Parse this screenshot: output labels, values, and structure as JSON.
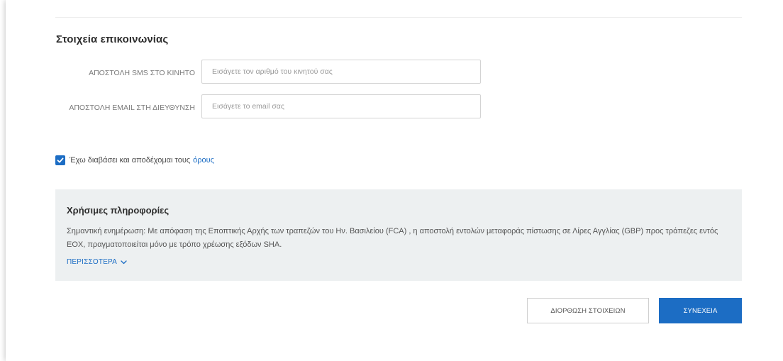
{
  "contact": {
    "title": "Στοιχεία επικοινωνίας",
    "sms_label": "ΑΠΟΣΤΟΛΗ SMS ΣΤΟ ΚΙΝΗΤΟ",
    "sms_placeholder": "Εισάγετε τον αριθμό του κινητού σας",
    "sms_value": "",
    "email_label": "ΑΠΟΣΤΟΛΗ EMAIL ΣΤΗ ΔΙΕΥΘΥΝΣΗ",
    "email_placeholder": "Εισάγετε το email σας",
    "email_value": ""
  },
  "terms": {
    "checked": true,
    "text": "Έχω διαβάσει και αποδέχομαι τους",
    "link_label": "όρους"
  },
  "info": {
    "title": "Χρήσιμες πληροφορίες",
    "body": "Σημαντική ενημέρωση: Με απόφαση της Εποπτικής Αρχής των τραπεζών του Ην. Βασιλείου (FCA) , η αποστολή εντολών μεταφοράς πίστωσης σε Λίρες Αγγλίας (GBP) προς τράπεζες εντός ΕΟΧ, πραγματοποιείται μόνο με τρόπο χρέωσης εξόδων SHA.",
    "more_label": "ΠΕΡΙΣΣΟΤΕΡΑ"
  },
  "actions": {
    "edit_label": "ΔΙΟΡΘΩΣΗ ΣΤΟΙΧΕΙΩΝ",
    "continue_label": "ΣΥΝΕΧΕΙΑ"
  },
  "colors": {
    "accent": "#1c6dc4",
    "info_background": "#edf0f1"
  },
  "icons": {
    "checkbox": "check-icon",
    "more": "chevron-down-icon"
  }
}
